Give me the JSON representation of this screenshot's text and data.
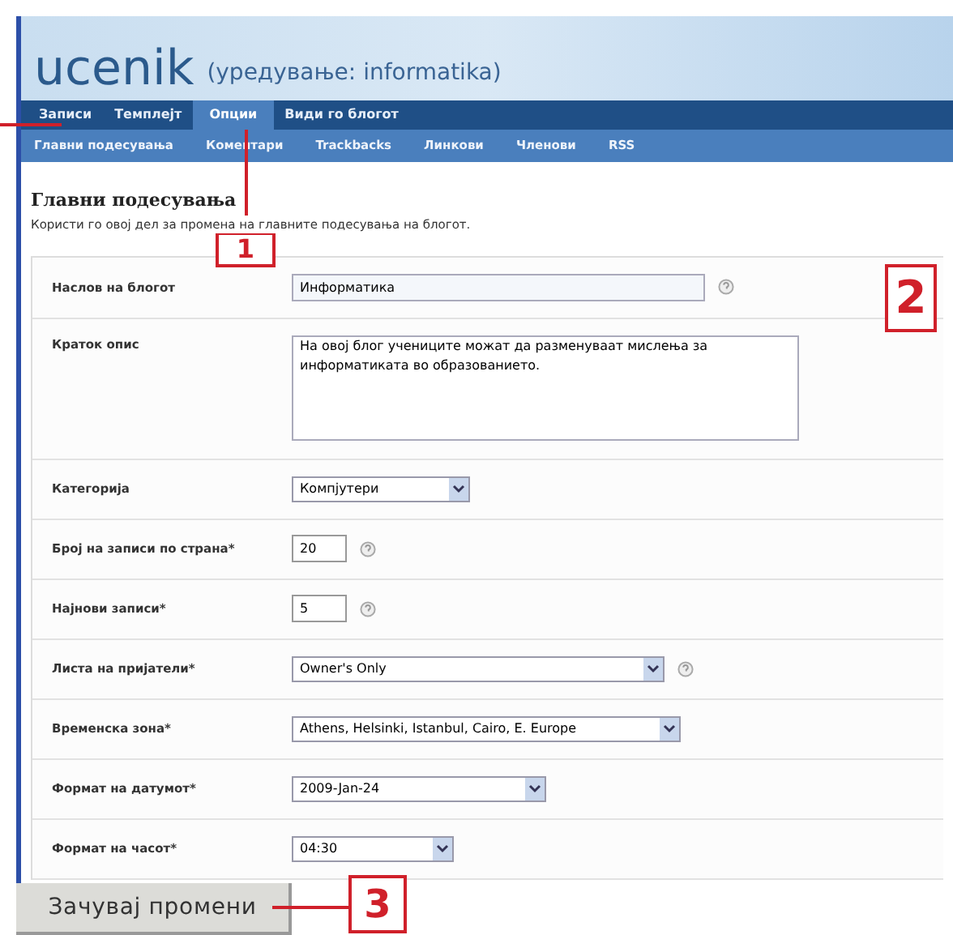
{
  "header": {
    "blog_name": "ucenik",
    "subtitle": "(уредување: informatika)"
  },
  "tabs": [
    {
      "label": "Записи",
      "selected": false
    },
    {
      "label": "Темплејт",
      "selected": false
    },
    {
      "label": "Опции",
      "selected": true
    },
    {
      "label": "Види го блогот",
      "selected": false
    }
  ],
  "subtabs": [
    "Главни подесувања",
    "Коментари",
    "Trackbacks",
    "Линкови",
    "Членови",
    "RSS"
  ],
  "section": {
    "title": "Главни подесувања",
    "description": "Користи го овој дел за промена на главните подесувања на блогот."
  },
  "fields": [
    {
      "label": "Наслов на блогот",
      "kind": "text",
      "value": "Информатика",
      "help": true
    },
    {
      "label": "Краток опис",
      "kind": "textarea",
      "value": "На овој блог учениците можат да разменуваат мислења за информатиката во образованието.",
      "help": false
    },
    {
      "label": "Категорија",
      "kind": "select",
      "value": "Компјутери",
      "help": false
    },
    {
      "label": "Број на записи по страна*",
      "kind": "number",
      "value": "20",
      "help": true
    },
    {
      "label": "Најнови записи*",
      "kind": "number",
      "value": "5",
      "help": true
    },
    {
      "label": "Листа на пријатели*",
      "kind": "select",
      "value": "Owner's Only",
      "help": true
    },
    {
      "label": "Временска зона*",
      "kind": "select",
      "value": "Athens, Helsinki, Istanbul, Cairo, E. Europe",
      "help": false
    },
    {
      "label": "Формат на датумот*",
      "kind": "select",
      "value": "2009-Jan-24",
      "help": false
    },
    {
      "label": "Формат на часот*",
      "kind": "select",
      "value": "04:30",
      "help": false
    }
  ],
  "save_button": "Зачувај промени",
  "callouts": [
    "1",
    "2",
    "3"
  ]
}
